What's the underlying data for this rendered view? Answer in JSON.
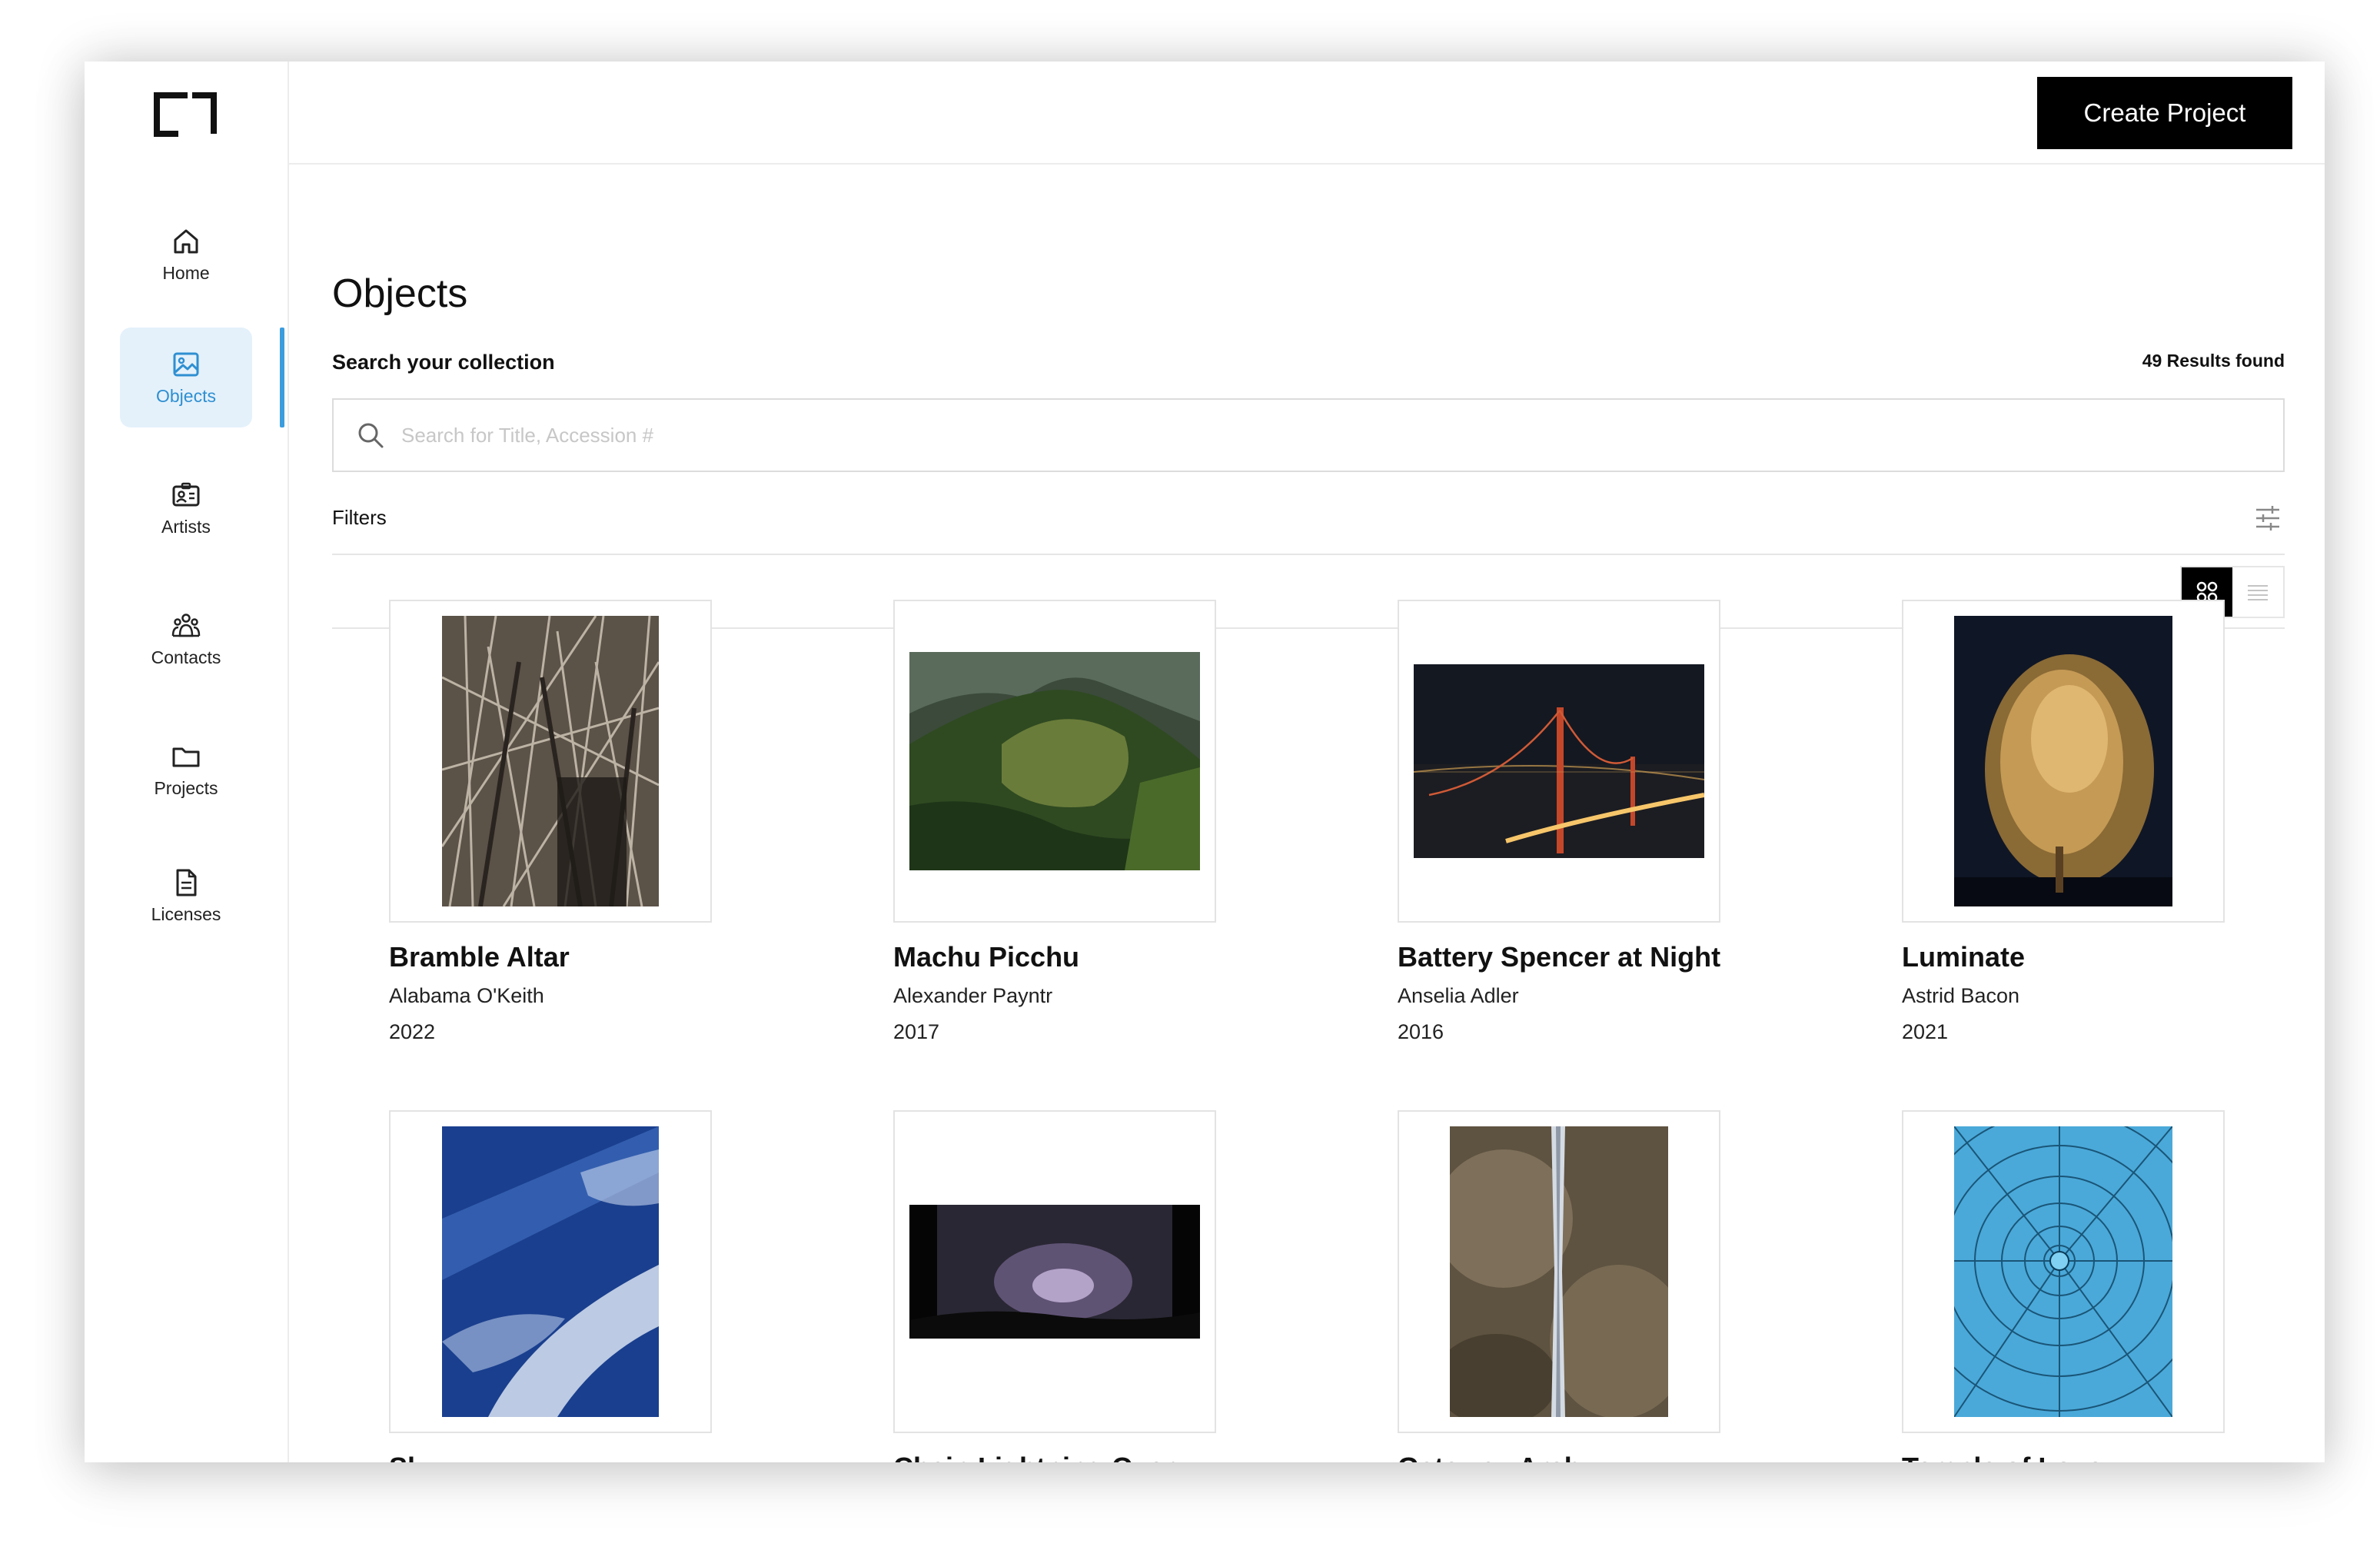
{
  "sidebar": {
    "items": [
      {
        "label": "Home",
        "icon": "home-icon"
      },
      {
        "label": "Objects",
        "icon": "image-icon"
      },
      {
        "label": "Artists",
        "icon": "id-card-icon"
      },
      {
        "label": "Contacts",
        "icon": "group-icon"
      },
      {
        "label": "Projects",
        "icon": "folder-icon"
      },
      {
        "label": "Licenses",
        "icon": "document-icon"
      }
    ],
    "active": "Objects",
    "active_color": "#2f8fd1"
  },
  "header": {
    "create_label": "Create Project"
  },
  "main": {
    "title": "Objects",
    "search_label": "Search your collection",
    "results": "49 Results found",
    "search_placeholder": "Search for Title, Accession #",
    "filters_label": "Filters",
    "view_mode": "grid"
  },
  "objects": [
    {
      "title": "Bramble Altar",
      "artist": "Alabama O'Keith",
      "year": "2022"
    },
    {
      "title": "Machu Picchu",
      "artist": "Alexander Payntr",
      "year": "2017"
    },
    {
      "title": "Battery Spencer at Night",
      "artist": "Anselia Adler",
      "year": "2016"
    },
    {
      "title": "Luminate",
      "artist": "Astrid Bacon",
      "year": "2021"
    },
    {
      "title": "Sky",
      "artist": "",
      "year": ""
    },
    {
      "title": "Chain Lightning Over",
      "artist": "",
      "year": ""
    },
    {
      "title": "Gateway Arch",
      "artist": "",
      "year": ""
    },
    {
      "title": "Temple of Love",
      "artist": "",
      "year": ""
    }
  ]
}
